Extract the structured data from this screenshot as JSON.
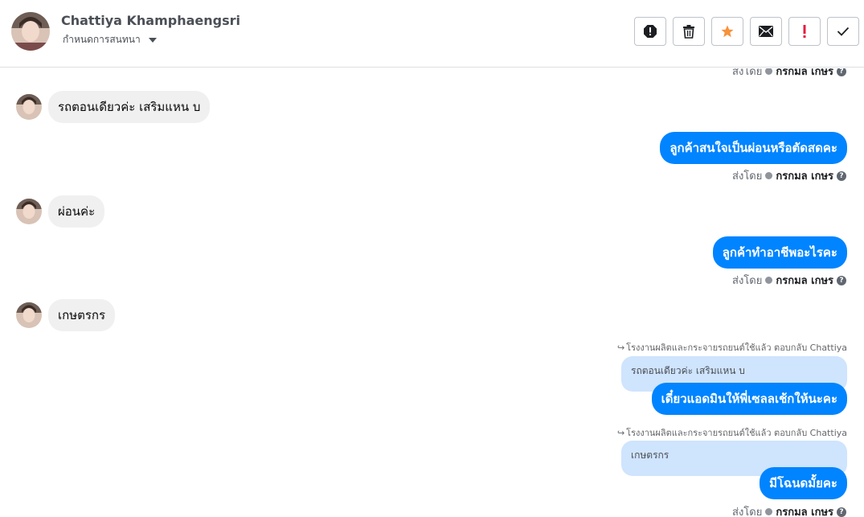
{
  "header": {
    "contact_name": "Chattiya Khamphaengsri",
    "conversation_settings": "กำหนดการสนทนา"
  },
  "toolbar": {
    "buttons": [
      {
        "name": "report-spam-button",
        "icon": "octagon-exclamation-icon"
      },
      {
        "name": "delete-button",
        "icon": "trash-icon"
      },
      {
        "name": "star-button",
        "icon": "star-icon"
      },
      {
        "name": "mark-unread-button",
        "icon": "envelope-icon"
      },
      {
        "name": "follow-up-button",
        "icon": "exclamation-icon"
      },
      {
        "name": "mark-done-button",
        "icon": "check-icon"
      }
    ],
    "star_color": "#f7923b",
    "alert_color": "#e41e3f"
  },
  "sent_by": {
    "prefix": "ส่งโดย",
    "agent": "กรกมล เกษร",
    "help": "?"
  },
  "messages": {
    "m1": "รถตอนเดียวค่ะ เสริมแหน บ",
    "m2": "ลูกค้าสนใจเป็นผ่อนหรือตัดสดคะ",
    "m3": "ผ่อนค่ะ",
    "m4": "ลูกค้าทำอาชีพอะไรคะ",
    "m5": "เกษตรกร",
    "m6": "เดี๋ยวแอดมินให้พี่เซลลเช้กให้นะคะ",
    "m7": "มีโฉนดมั้ยคะ"
  },
  "replies": {
    "note": "โรงงานผลิตและกระจายรถยนต์ใช้แล้ว ตอบกลับ Chattiya",
    "quote1": "รถตอนเดียวค่ะ เสริมแหน บ",
    "quote2": "เกษตรกร"
  },
  "colors": {
    "outgoing_bubble": "#0084ff",
    "incoming_bubble": "#f0f0f0",
    "quote_bubble": "#cfe4fd"
  }
}
